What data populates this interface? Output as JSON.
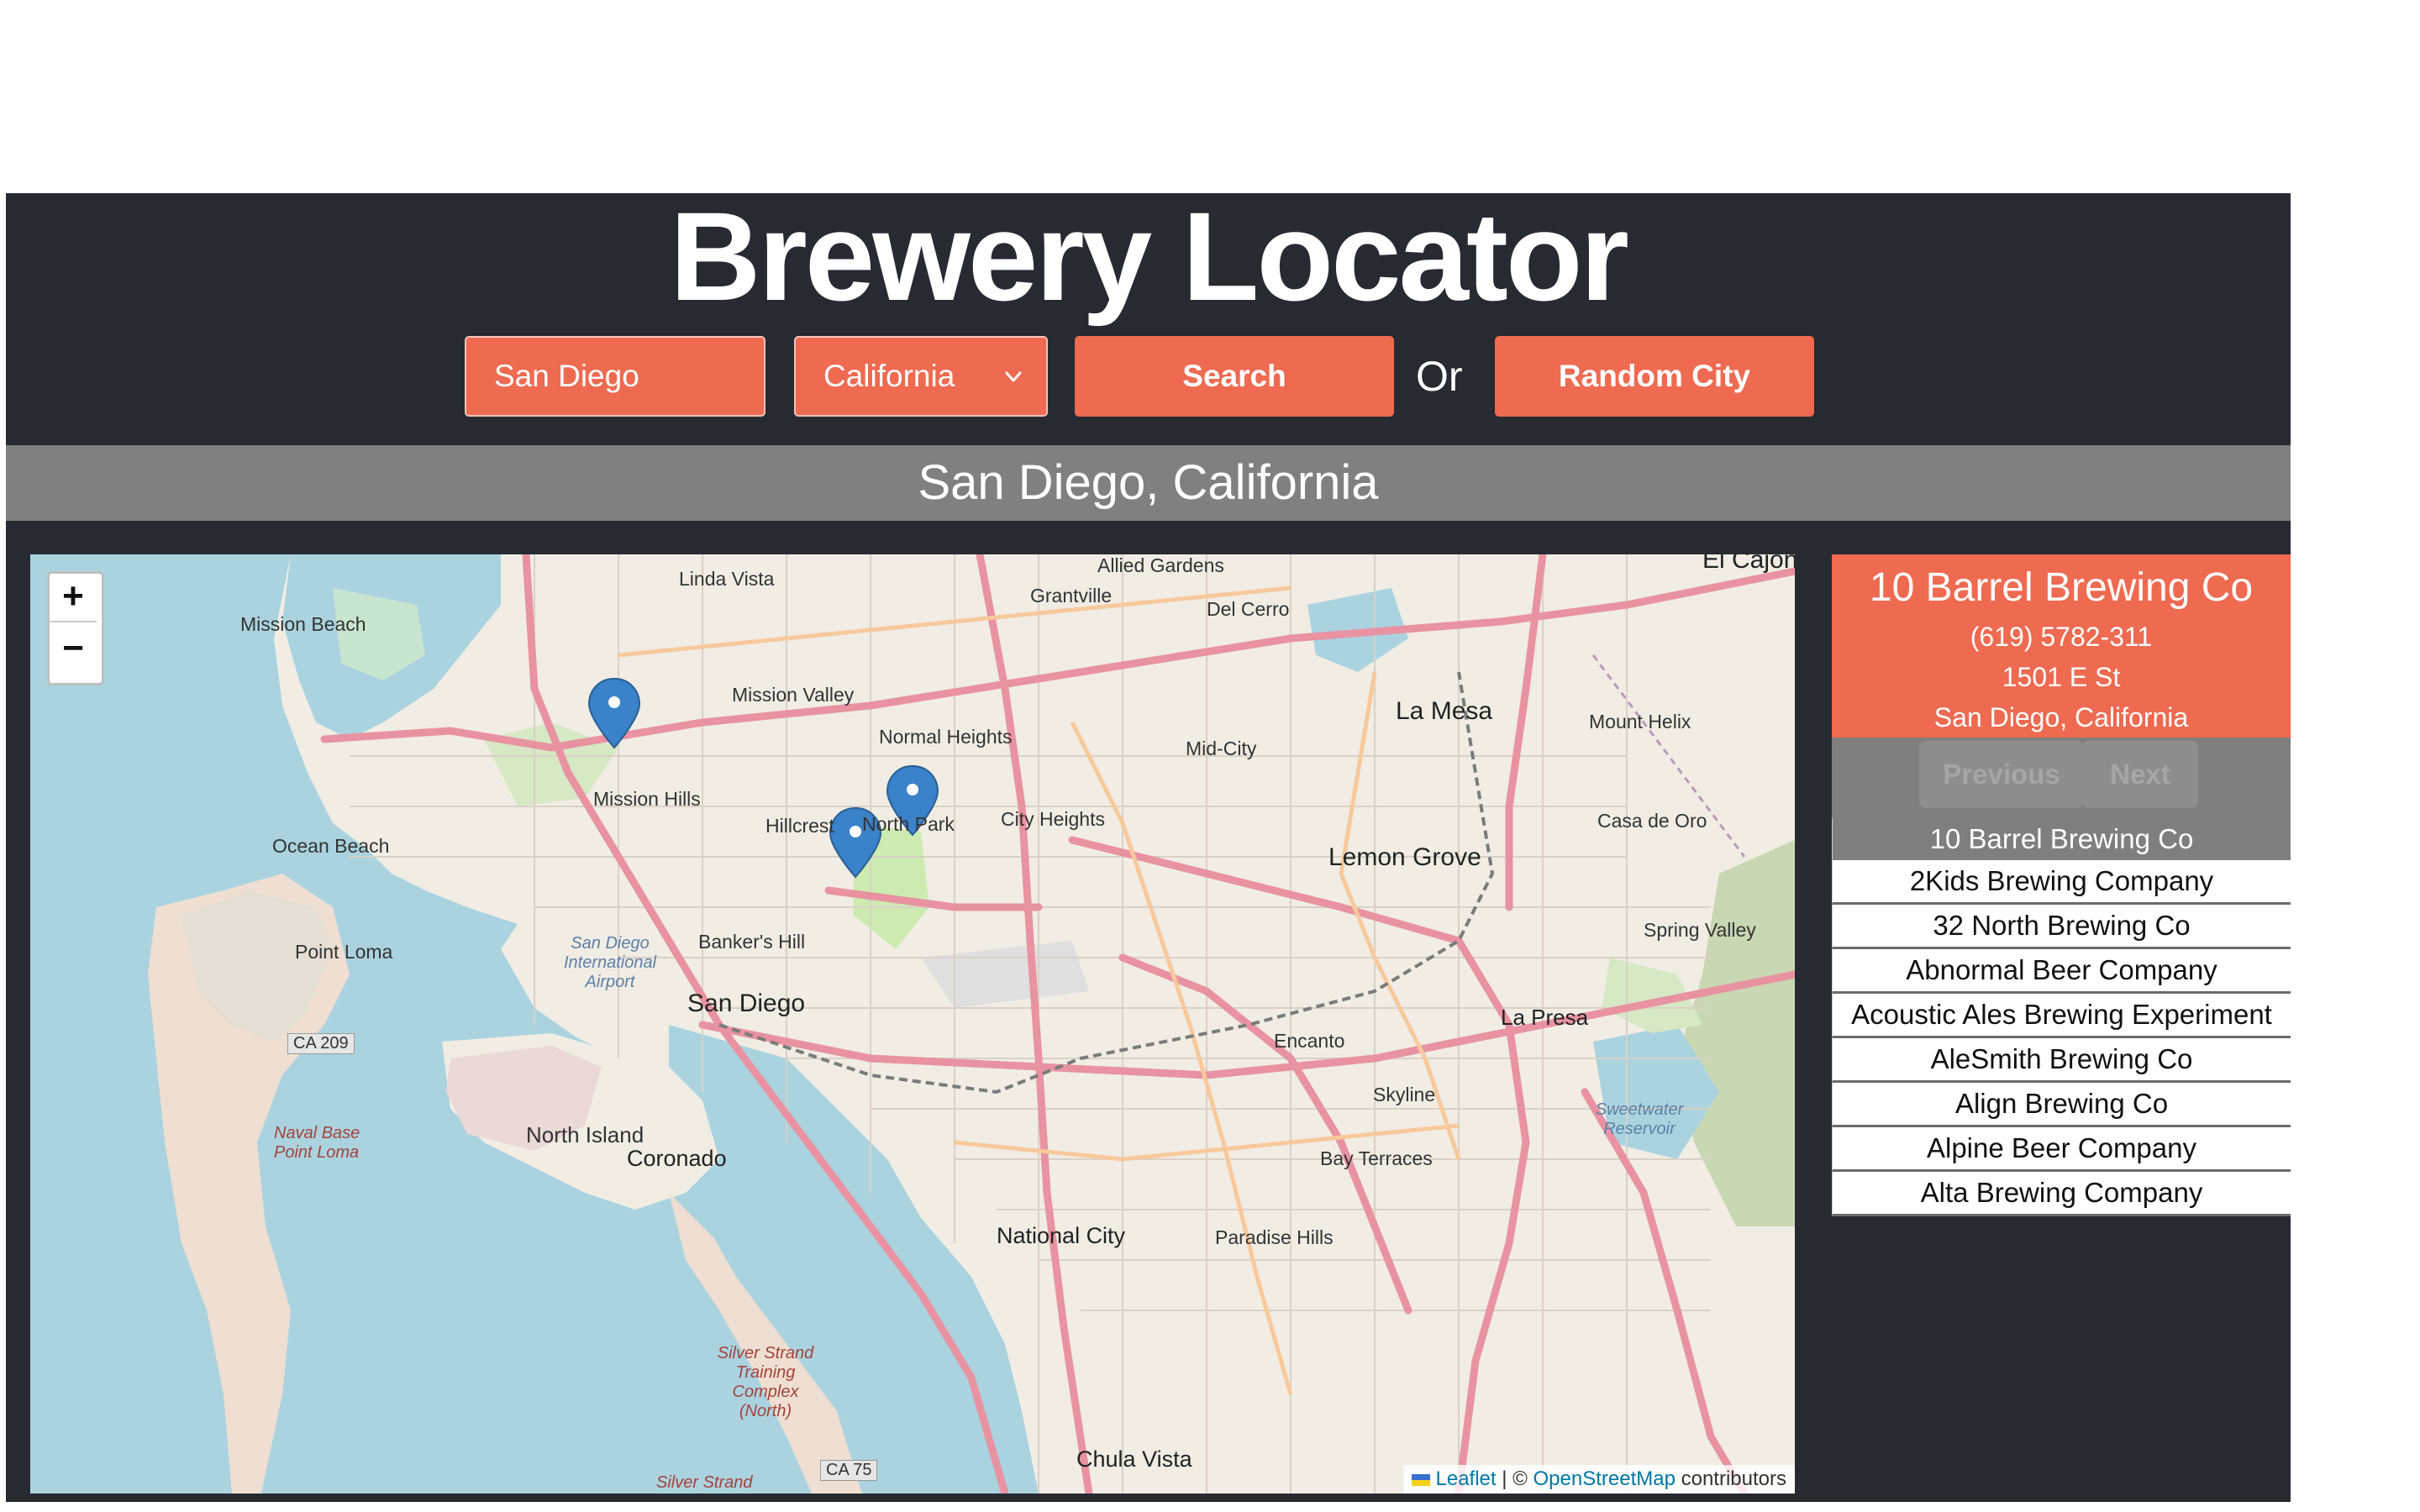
{
  "header": {
    "title": "Brewery Locator",
    "city_value": "San Diego",
    "state_value": "California",
    "search_label": "Search",
    "or_label": "Or",
    "random_label": "Random City"
  },
  "location_bar": {
    "text": "San Diego, California"
  },
  "map": {
    "zoom_in": "+",
    "zoom_out": "−",
    "attribution": {
      "leaflet": "Leaflet",
      "sep": " | © ",
      "osm": "OpenStreetMap",
      "suffix": " contributors"
    },
    "labels": {
      "linda_vista": "Linda Vista",
      "allied_gardens": "Allied Gardens",
      "grantville": "Grantville",
      "del_cerro": "Del Cerro",
      "el_cajon": "El Cajon",
      "mission_beach": "Mission Beach",
      "mission_valley": "Mission Valley",
      "normal_heights": "Normal Heights",
      "mid_city": "Mid-City",
      "la_mesa": "La Mesa",
      "mount_helix": "Mount Helix",
      "mission_hills": "Mission Hills",
      "hillcrest": "Hillcrest",
      "north_park": "North Park",
      "city_heights": "City Heights",
      "casa_de_oro": "Casa de Oro",
      "ocean_beach": "Ocean Beach",
      "lemon_grove": "Lemon Grove",
      "bankers_hill": "Banker's Hill",
      "spring_valley": "Spring Valley",
      "point_loma": "Point Loma",
      "airport": "San Diego International Airport",
      "san_diego": "San Diego",
      "la_presa": "La Presa",
      "encanto": "Encanto",
      "ca209": "CA 209",
      "skyline": "Skyline",
      "north_island": "North Island",
      "naval_base": "Naval Base Point Loma",
      "coronado": "Coronado",
      "bay_terraces": "Bay Terraces",
      "sweetwater": "Sweetwater Reservoir",
      "national_city": "National City",
      "paradise_hills": "Paradise Hills",
      "silver_strand_training": "Silver Strand Training Complex (North)",
      "ca75": "CA 75",
      "chula_vista": "Chula Vista",
      "silver_strand": "Silver Strand"
    }
  },
  "selected": {
    "name": "10 Barrel Brewing Co",
    "phone": "(619) 5782-311",
    "street": "1501 E St",
    "city_state": "San Diego, California"
  },
  "pager": {
    "previous": "Previous",
    "next": "Next"
  },
  "breweries": [
    "10 Barrel Brewing Co",
    "2Kids Brewing Company",
    "32 North Brewing Co",
    "Abnormal Beer Company",
    "Acoustic Ales Brewing Experiment",
    "AleSmith Brewing Co",
    "Align Brewing Co",
    "Alpine Beer Company",
    "Alta Brewing Company"
  ],
  "colors": {
    "accent": "#ee6a50",
    "header_bg": "#272a31",
    "bar_gray": "#808080",
    "marker": "#3a82c9"
  }
}
